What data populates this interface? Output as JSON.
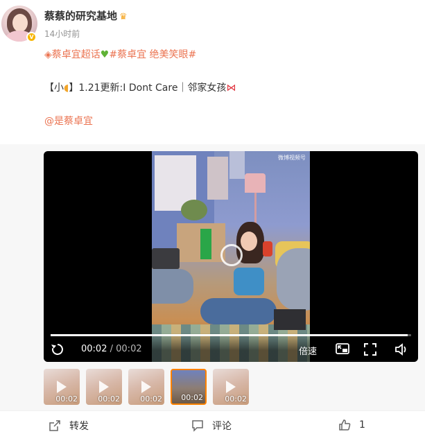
{
  "post": {
    "author": "蔡蔡的研究基地",
    "timestamp": "14小时前",
    "verified_badge": "V",
    "topic_line": {
      "topic1": "蔡卓宜超话",
      "topic2": "#蔡卓宜 绝美笑眼#",
      "hash": "#"
    },
    "content_line": {
      "prefix": "【小",
      "suffix": "】1.21更新:I Dont Care｜邻家女孩"
    },
    "mention": "@是蔡卓宜"
  },
  "video": {
    "watermark": "微博视频号",
    "current_time": "00:02",
    "separator": "/",
    "total_time": "00:02",
    "speed_label": "倍速",
    "progress": 0.99
  },
  "thumbnails": [
    {
      "duration": "00:02",
      "active": false
    },
    {
      "duration": "00:02",
      "active": false
    },
    {
      "duration": "00:02",
      "active": false
    },
    {
      "duration": "00:02",
      "active": true
    },
    {
      "duration": "00:02",
      "active": false
    }
  ],
  "actions": {
    "repost": "转发",
    "comment": "评论",
    "like_count": "1"
  },
  "colors": {
    "link": "#eb7350",
    "accent": "#ff8200",
    "verified": "#f7b500"
  },
  "icons": [
    "crown-icon",
    "diamond-icon",
    "green-heart-icon",
    "mango-icon",
    "bow-icon",
    "replay-icon",
    "pip-icon",
    "fullscreen-icon",
    "volume-icon",
    "repost-icon",
    "comment-icon",
    "like-icon"
  ]
}
